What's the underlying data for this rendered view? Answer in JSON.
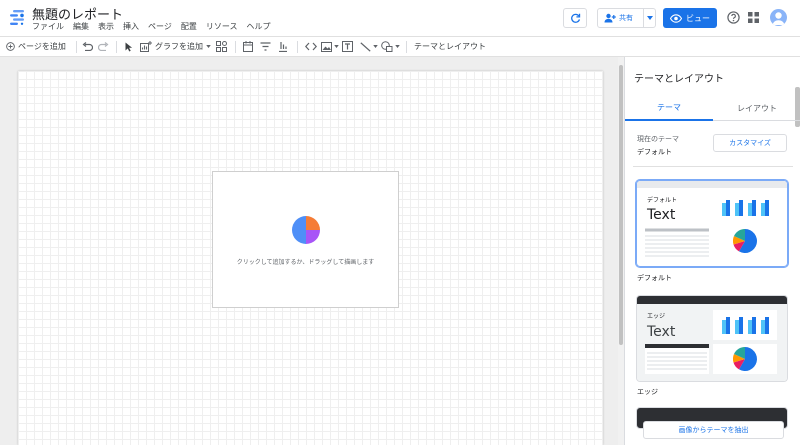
{
  "app": {
    "title": "無題のレポート",
    "menu": [
      "ファイル",
      "編集",
      "表示",
      "挿入",
      "ページ",
      "配置",
      "リソース",
      "ヘルプ"
    ]
  },
  "header": {
    "share_label": "共有",
    "view_label": "ビュー"
  },
  "toolbar": {
    "add_page_label": "ページを追加",
    "add_chart_label": "グラフを追加",
    "theme_layout_label": "テーマとレイアウト"
  },
  "canvas": {
    "placeholder_text": "クリックして追加するか、ドラッグして描画します"
  },
  "panel": {
    "title": "テーマとレイアウト",
    "tabs": [
      {
        "label": "テーマ",
        "active": true
      },
      {
        "label": "レイアウト",
        "active": false
      }
    ],
    "current_theme_label": "現在のテーマ",
    "current_theme_value": "デフォルト",
    "customize_label": "カスタマイズ",
    "themes": [
      {
        "name": "デフォルト",
        "preview_title": "デフォルト",
        "preview_text": "Text"
      },
      {
        "name": "エッジ",
        "preview_title": "エッジ",
        "preview_text": "Text"
      }
    ],
    "extract_label": "画像からテーマを抽出"
  },
  "colors": {
    "accent": "#1a73e8",
    "bar": "#1a73e8",
    "bar_light": "#4fc3f7",
    "edge_header": "#2d2f33"
  }
}
